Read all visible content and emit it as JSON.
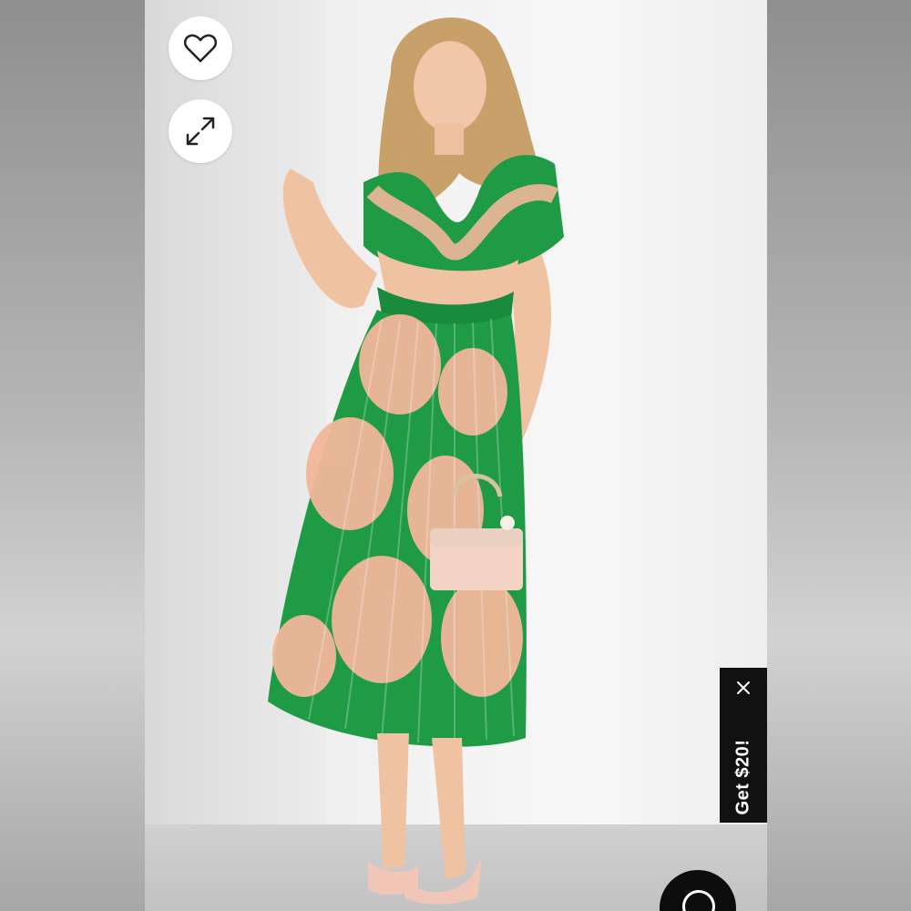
{
  "icons": {
    "wishlist": "heart-icon",
    "expand": "expand-arrows-icon",
    "close": "close-icon",
    "chat": "chat-bubble-icon"
  },
  "promo": {
    "label": "Get $20!"
  },
  "colors": {
    "dress_green": "#1f9a45",
    "dress_peach": "#f1b79a",
    "promo_bg": "#111111",
    "wall": "#f2f2f2"
  }
}
